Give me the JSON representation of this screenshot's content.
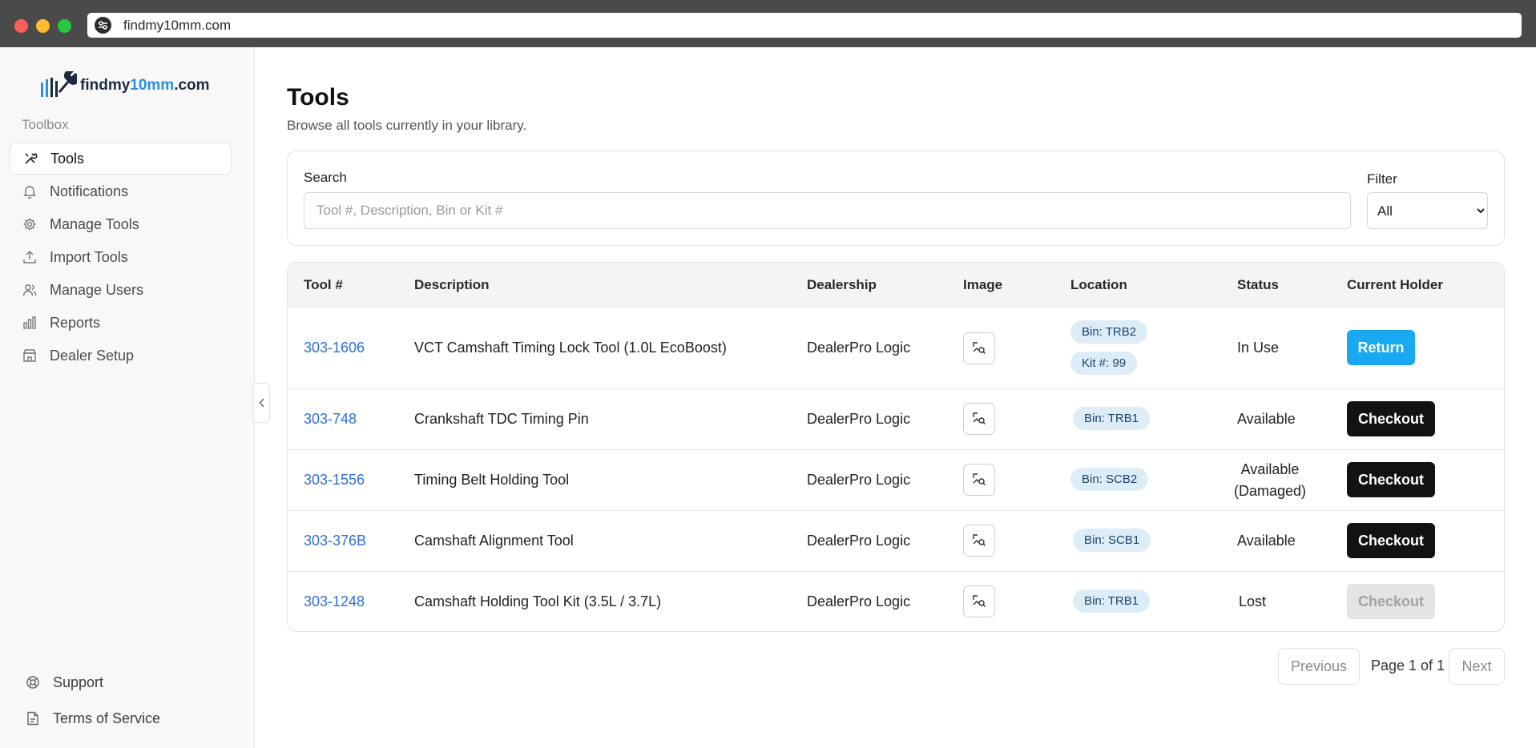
{
  "browser": {
    "url": "findmy10mm.com"
  },
  "brand": {
    "name_prefix": "findmy",
    "name_highlight": "10mm",
    "name_suffix": ".com"
  },
  "sidebar": {
    "section_label": "Toolbox",
    "items": [
      {
        "label": "Tools",
        "icon": "tools-icon",
        "active": true
      },
      {
        "label": "Notifications",
        "icon": "bell-icon"
      },
      {
        "label": "Manage Tools",
        "icon": "gear-icon"
      },
      {
        "label": "Import Tools",
        "icon": "upload-icon"
      },
      {
        "label": "Manage Users",
        "icon": "users-icon"
      },
      {
        "label": "Reports",
        "icon": "bar-chart-icon"
      },
      {
        "label": "Dealer Setup",
        "icon": "store-icon"
      }
    ],
    "footer": [
      {
        "label": "Support",
        "icon": "lifebuoy-icon"
      },
      {
        "label": "Terms of Service",
        "icon": "document-icon"
      }
    ]
  },
  "page": {
    "title": "Tools",
    "subtitle": "Browse all tools currently in your library."
  },
  "search": {
    "label": "Search",
    "placeholder": "Tool #, Description, Bin or Kit #",
    "value": ""
  },
  "filter": {
    "label": "Filter",
    "selected": "All"
  },
  "table": {
    "headers": [
      "Tool #",
      "Description",
      "Dealership",
      "Image",
      "Location",
      "Status",
      "Current Holder"
    ],
    "rows": [
      {
        "tool": "303-1606",
        "description": "VCT Camshaft Timing Lock Tool (1.0L EcoBoost)",
        "dealership": "DealerPro Logic",
        "bin": "Bin: TRB2",
        "kit": "Kit #: 99",
        "status": "In Use",
        "action": "Return"
      },
      {
        "tool": "303-748",
        "description": "Crankshaft TDC Timing Pin",
        "dealership": "DealerPro Logic",
        "bin": "Bin: TRB1",
        "status": "Available",
        "action": "Checkout"
      },
      {
        "tool": "303-1556",
        "description": "Timing Belt Holding Tool",
        "dealership": "DealerPro Logic",
        "bin": "Bin: SCB2",
        "status": "Available",
        "status2": "(Damaged)",
        "action": "Checkout"
      },
      {
        "tool": "303-376B",
        "description": "Camshaft Alignment Tool",
        "dealership": "DealerPro Logic",
        "bin": "Bin: SCB1",
        "status": "Available",
        "action": "Checkout"
      },
      {
        "tool": "303-1248",
        "description": "Camshaft Holding Tool Kit (3.5L / 3.7L)",
        "dealership": "DealerPro Logic",
        "bin": "Bin: TRB1",
        "status": "Lost",
        "action": "Checkout",
        "action_disabled": true
      }
    ]
  },
  "pagination": {
    "previous": "Previous",
    "page_text": "Page 1 of 1",
    "next": "Next"
  },
  "colors": {
    "accent": "#18a9f2",
    "link": "#2f6fdb",
    "chip_bg": "#dcedf8",
    "checkout": "#121212"
  }
}
